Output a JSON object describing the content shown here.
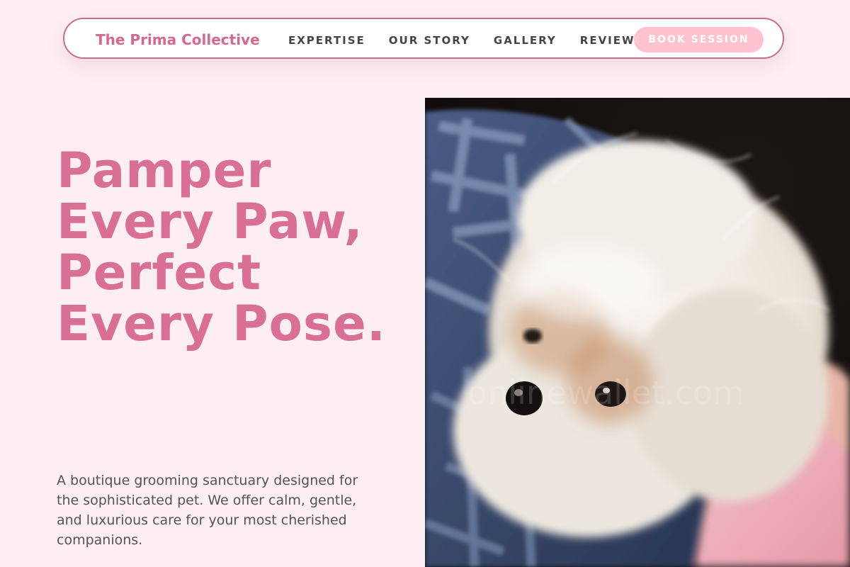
{
  "brand": "The Prima Collective",
  "nav": {
    "links": [
      "EXPERTISE",
      "OUR STORY",
      "GALLERY",
      "REVIEWS"
    ],
    "cta": "BOOK SESSION"
  },
  "hero": {
    "headline": "Pamper Every Paw, Perfect Every Pose.",
    "description": "A boutique grooming sanctuary designed for the sophisticated pet. We offer calm, gentle, and luxurious care for your most cherished companions.",
    "image_subject": "fluffy white dog wrapped in blue plaid blanket",
    "watermark": "onlinewallet.com"
  },
  "colors": {
    "page_bg": "#fdeef3",
    "brand_pink": "#d4688f",
    "headline_pink": "#d96f94",
    "button_pink": "#ffc3cf",
    "nav_border": "#c96c8d",
    "text_dark": "#444444"
  }
}
